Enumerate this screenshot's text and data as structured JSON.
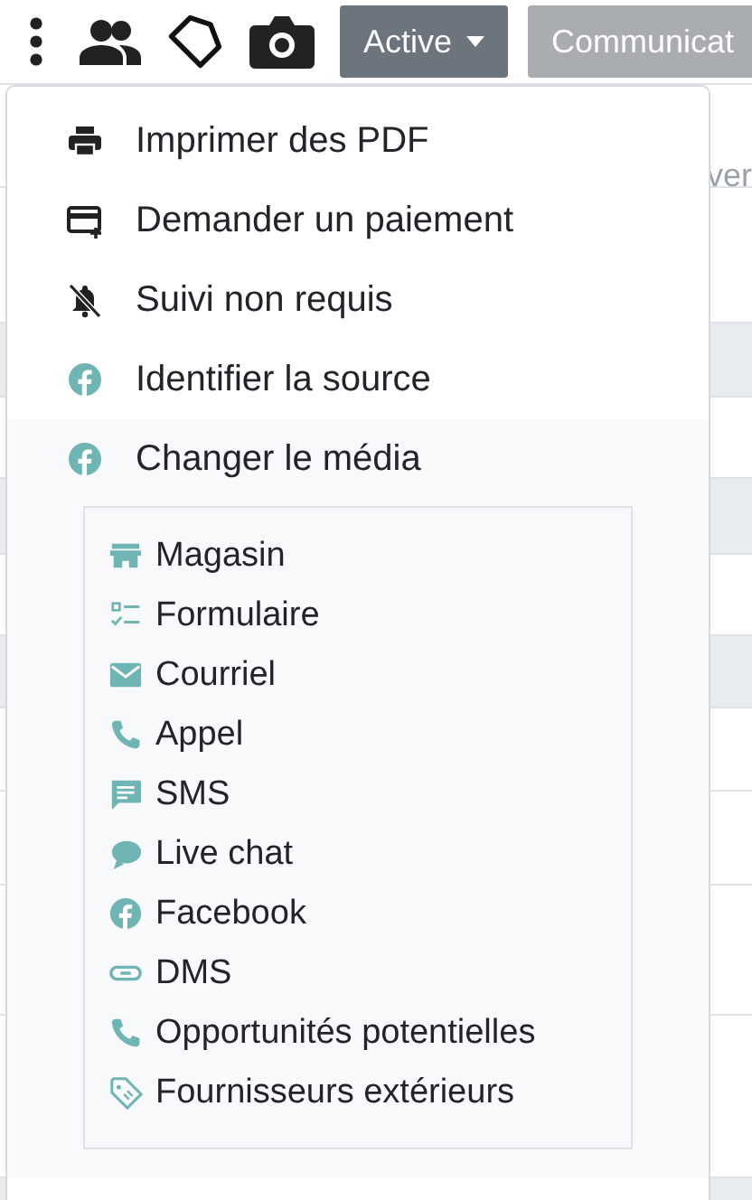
{
  "toolbar": {
    "buttons": [
      {
        "label": "Active",
        "selected": true,
        "caret": true
      },
      {
        "label": "Communicat",
        "selected": false,
        "caret": false
      }
    ]
  },
  "background_table": {
    "header_fragment": "ver"
  },
  "menu": {
    "items": [
      {
        "label": "Imprimer des PDF",
        "expanded": false
      },
      {
        "label": "Demander un paiement",
        "expanded": false
      },
      {
        "label": "Suivi non requis",
        "expanded": false
      },
      {
        "label": "Identifier la source",
        "expanded": false
      },
      {
        "label": "Changer le média",
        "expanded": true,
        "children": [
          {
            "label": "Magasin"
          },
          {
            "label": "Formulaire"
          },
          {
            "label": "Courriel"
          },
          {
            "label": "Appel"
          },
          {
            "label": "SMS"
          },
          {
            "label": "Live chat"
          },
          {
            "label": "Facebook"
          },
          {
            "label": "DMS"
          },
          {
            "label": "Opportunités potentielles"
          },
          {
            "label": "Fournisseurs extérieurs"
          }
        ]
      }
    ]
  }
}
